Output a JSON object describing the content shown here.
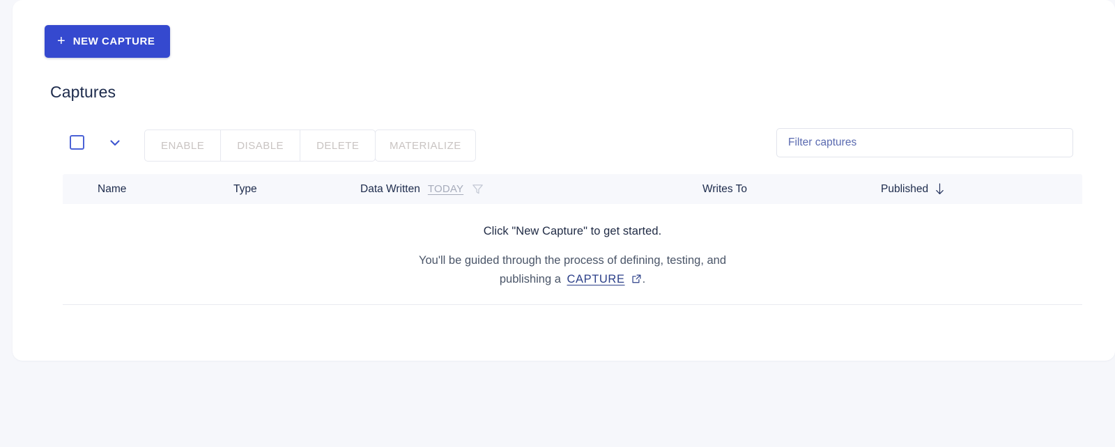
{
  "new_capture_button": {
    "label": "NEW CAPTURE",
    "icon": "plus-icon",
    "color": "#3549cf"
  },
  "section": {
    "title": "Captures"
  },
  "toolbar": {
    "select_all": {
      "icon": "checkbox-icon",
      "checked": false
    },
    "select_menu": {
      "icon": "chevron-down-icon"
    },
    "actions": [
      {
        "label": "ENABLE",
        "disabled": true
      },
      {
        "label": "DISABLE",
        "disabled": true
      },
      {
        "label": "DELETE",
        "disabled": true
      }
    ],
    "materialize": {
      "label": "MATERIALIZE",
      "disabled": true
    },
    "filter": {
      "placeholder": "Filter captures",
      "value": ""
    }
  },
  "table": {
    "columns": [
      {
        "label": "Name"
      },
      {
        "label": "Type"
      },
      {
        "label": "Data Written"
      },
      {
        "label": "Writes To"
      },
      {
        "label": "Published"
      }
    ],
    "data_written_filter": {
      "label": "TODAY",
      "icon": "funnel-icon"
    },
    "published_sort": {
      "icon": "arrow-down-icon",
      "direction": "desc"
    },
    "rows": []
  },
  "empty_state": {
    "title": "Click \"New Capture\" to get started.",
    "description_before": "You'll be guided through the process of defining, testing, and publishing a",
    "link_label": "CAPTURE",
    "link_icon": "external-link-icon",
    "description_after": "."
  },
  "colors": {
    "accent": "#3549cf",
    "page_background": "#f6f7fb",
    "card_background": "#ffffff",
    "table_header_background": "#f7f8fc",
    "disabled_text": "#c9c4c2",
    "link": "#2b3f88"
  }
}
